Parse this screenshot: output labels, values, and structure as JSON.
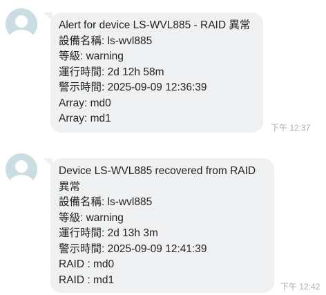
{
  "messages": [
    {
      "lines": [
        "Alert for device LS-WVL885 - RAID 異常",
        "設備名稱: ls-wvl885",
        "等級: warning",
        "運行時間: 2d 12h 58m",
        "警示時間: 2025-09-09 12:36:39",
        "Array: md0",
        "Array: md1"
      ],
      "time": "下午 12:37"
    },
    {
      "lines": [
        "Device LS-WVL885 recovered from RAID",
        "異常",
        "設備名稱: ls-wvl885",
        "等級: warning",
        "運行時間: 2d 13h 3m",
        "警示時間: 2025-09-09 12:41:39",
        "RAID : md0",
        "RAID : md1"
      ],
      "time": "下午 12:42"
    }
  ],
  "icons": {
    "avatar": "user-avatar-icon"
  },
  "colors": {
    "bubble": "#eef0f2",
    "avatar": "#c9dde3",
    "timestamp": "#a8adb3"
  }
}
